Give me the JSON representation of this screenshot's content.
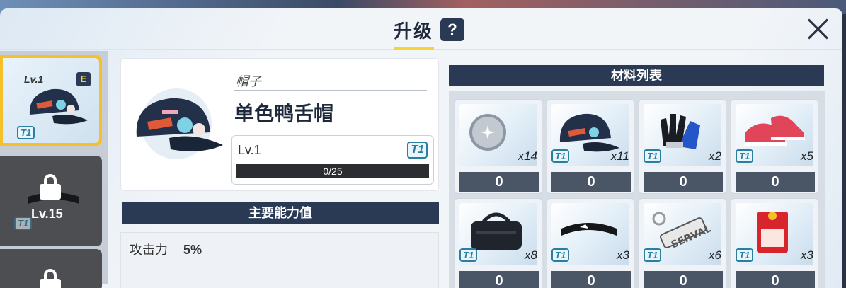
{
  "header": {
    "title": "升级",
    "help_label": "?",
    "close_label": "close"
  },
  "sidebar": {
    "items": [
      {
        "level": "Lv.1",
        "rank": "E",
        "tier": "T1",
        "state": "selected"
      },
      {
        "level": "Lv.15",
        "tier": "T1",
        "state": "locked"
      },
      {
        "state": "locked"
      }
    ]
  },
  "item": {
    "category": "帽子",
    "name": "单色鸭舌帽",
    "level": "Lv.1",
    "tier": "T1",
    "exp": "0/25",
    "exp_progress": 0
  },
  "stats": {
    "heading": "主要能力值",
    "rows": [
      {
        "label": "攻击力",
        "value": "5%"
      }
    ]
  },
  "materials": {
    "heading": "材料列表",
    "items": [
      {
        "icon": "orb-icon",
        "count": "x14",
        "tier": "",
        "value": "0"
      },
      {
        "icon": "cap-icon",
        "count": "x11",
        "tier": "T1",
        "value": "0"
      },
      {
        "icon": "glove-icon",
        "count": "x2",
        "tier": "T1",
        "value": "0"
      },
      {
        "icon": "sneaker-icon",
        "count": "x5",
        "tier": "T1",
        "value": "0"
      },
      {
        "icon": "bag-icon",
        "count": "x8",
        "tier": "T1",
        "value": "0"
      },
      {
        "icon": "headband-icon",
        "count": "x3",
        "tier": "T1",
        "value": "0"
      },
      {
        "icon": "keychain-icon",
        "count": "x6",
        "tier": "T1",
        "value": "0"
      },
      {
        "icon": "charm-icon",
        "count": "x3",
        "tier": "T1",
        "value": "0"
      }
    ]
  },
  "colors": {
    "accent": "#f6d33a",
    "header_bar": "#2a3a55",
    "value_bar": "#4a5566"
  }
}
